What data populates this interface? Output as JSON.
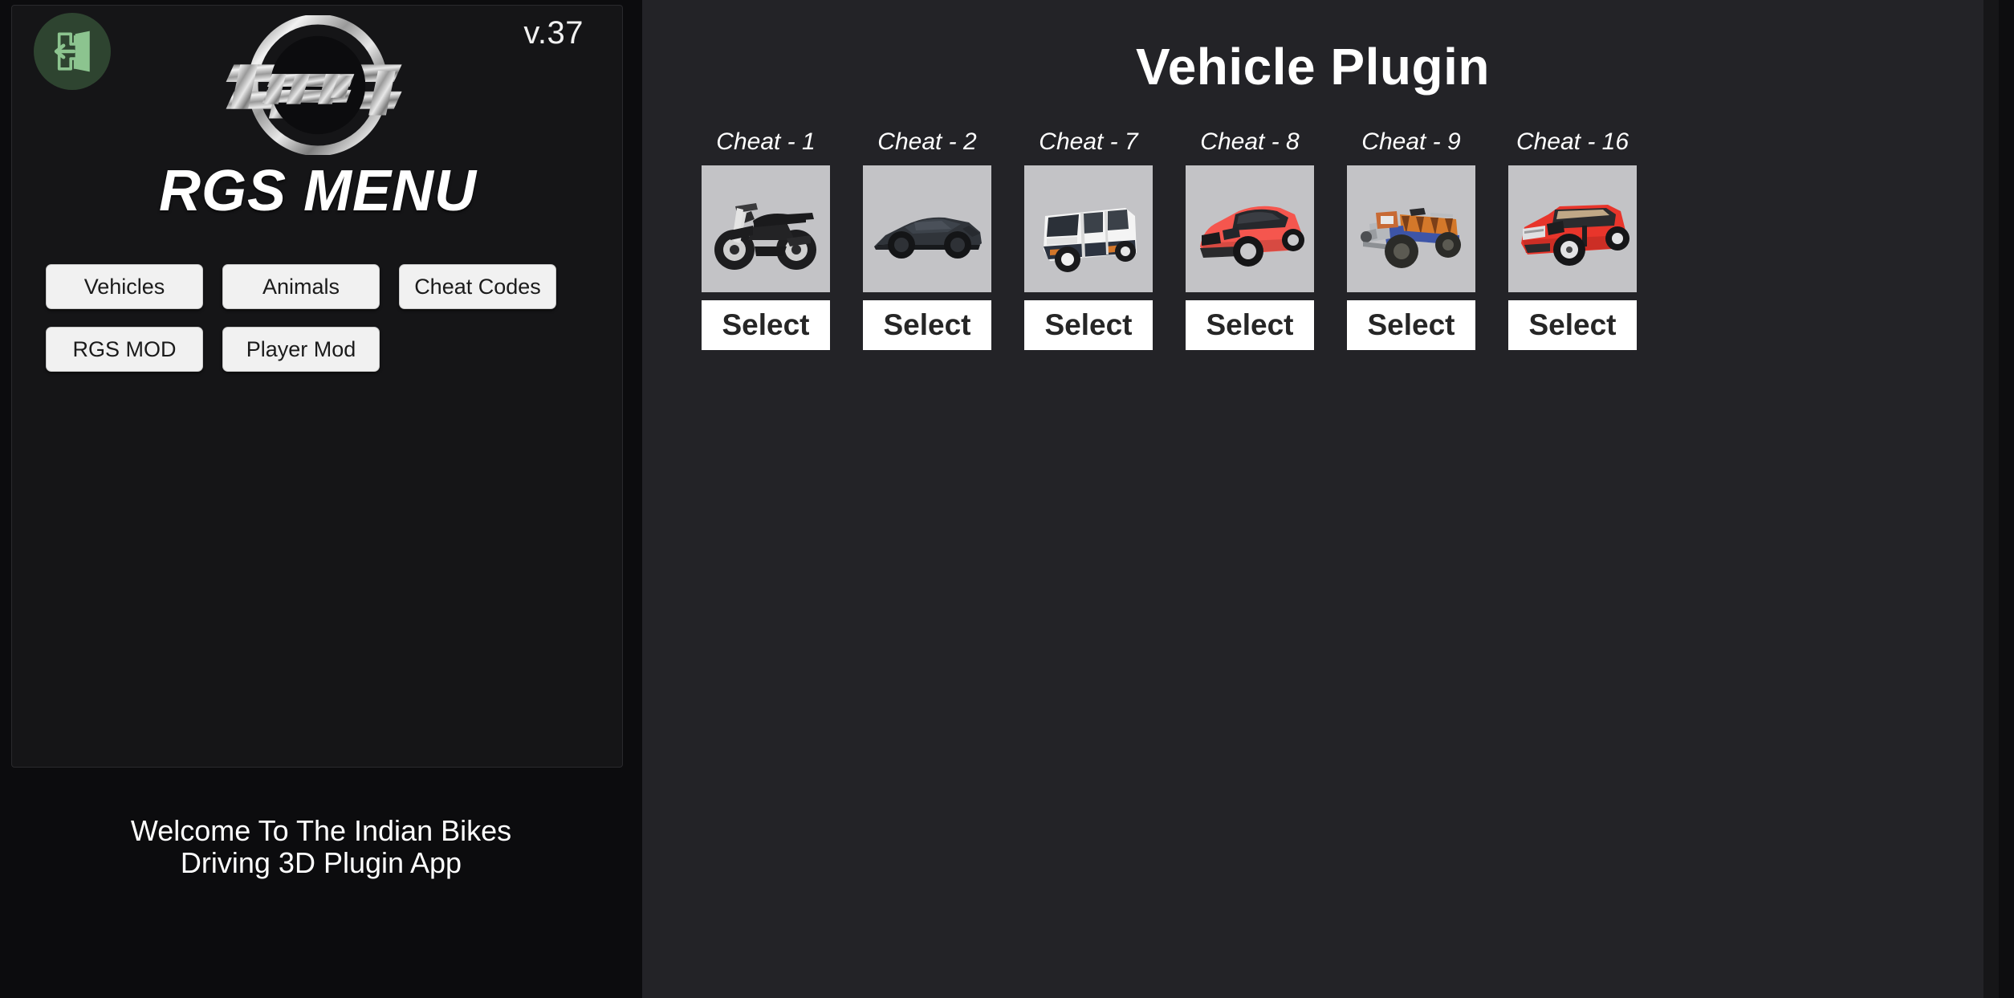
{
  "sidebar": {
    "version": "v.37",
    "exit_icon": "exit-door-icon",
    "logo_text": "RGS",
    "menu_title": "RGS MENU",
    "buttons": [
      {
        "label": "Vehicles"
      },
      {
        "label": "Animals"
      },
      {
        "label": "Cheat Codes"
      },
      {
        "label": "RGS MOD"
      },
      {
        "label": "Player Mod"
      }
    ],
    "welcome": "Welcome To The Indian Bikes\nDriving 3D Plugin App"
  },
  "main": {
    "title": "Vehicle Plugin",
    "select_label": "Select",
    "cards": [
      {
        "label": "Cheat - 1",
        "vehicle": "motorcycle",
        "select": "Select"
      },
      {
        "label": "Cheat - 2",
        "vehicle": "supercar",
        "select": "Select"
      },
      {
        "label": "Cheat - 7",
        "vehicle": "white-van",
        "select": "Select"
      },
      {
        "label": "Cheat - 8",
        "vehicle": "red-hatchback",
        "select": "Select"
      },
      {
        "label": "Cheat - 9",
        "vehicle": "three-wheeler-tractor",
        "select": "Select"
      },
      {
        "label": "Cheat - 16",
        "vehicle": "red-suv",
        "select": "Select"
      }
    ]
  },
  "colors": {
    "sidebar_bg": "#0c0c0e",
    "sidebar_panel_bg": "#151517",
    "main_bg": "#232327",
    "thumb_bg": "#c3c3c6",
    "button_bg": "#f1f1f1",
    "select_bg": "#ffffff",
    "exit_circle": "#2e4430",
    "exit_icon": "#8cc48f",
    "text_light": "#ffffff",
    "accent_red": "#e8352b",
    "accent_coral": "#f5564e",
    "accent_blue": "#3d55a8",
    "accent_orange": "#d4782a"
  }
}
